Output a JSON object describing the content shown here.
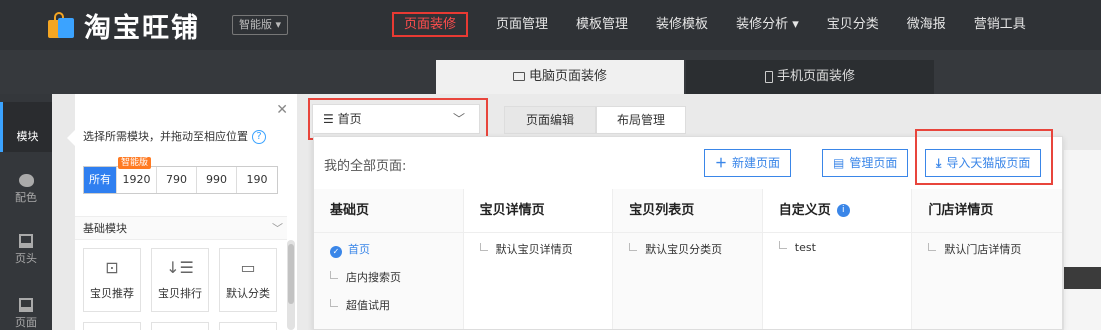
{
  "brand": {
    "name": "淘宝旺铺",
    "edition": "智能版 ▾"
  },
  "nav": [
    {
      "label": "页面装修",
      "active": true
    },
    {
      "label": "页面管理"
    },
    {
      "label": "模板管理"
    },
    {
      "label": "装修模板"
    },
    {
      "label": "装修分析 ▾"
    },
    {
      "label": "宝贝分类"
    },
    {
      "label": "微海报"
    },
    {
      "label": "营销工具"
    }
  ],
  "tabs": {
    "pc": "电脑页面装修",
    "mobile": "手机页面装修"
  },
  "rail": [
    {
      "label": "模块",
      "icon": "grid-icon",
      "active": true
    },
    {
      "label": "配色",
      "icon": "palette-icon"
    },
    {
      "label": "页头",
      "icon": "header-icon"
    },
    {
      "label": "页面",
      "icon": "page-icon"
    }
  ],
  "panel": {
    "hint": "选择所需模块，并拖动至相应位置",
    "help": "?",
    "widths": [
      "所有",
      "1920",
      "790",
      "990",
      "190"
    ],
    "width_badge": "智能版",
    "section": "基础模块",
    "modules": [
      {
        "label": "宝贝推荐",
        "icon": "bag-icon"
      },
      {
        "label": "宝贝排行",
        "icon": "sort-list-icon"
      },
      {
        "label": "默认分类",
        "icon": "category-icon"
      }
    ]
  },
  "toolbar": {
    "page_select": "首页",
    "edit_tab": "页面编辑",
    "layout_tab": "布局管理"
  },
  "dropdown": {
    "title": "我的全部页面:",
    "new_page": "新建页面",
    "manage_page": "管理页面",
    "import_page": "导入天猫版页面",
    "columns": [
      {
        "title": "基础页",
        "items": [
          "首页",
          "店内搜索页",
          "超值试用"
        ]
      },
      {
        "title": "宝贝详情页",
        "items": [
          "默认宝贝详情页"
        ]
      },
      {
        "title": "宝贝列表页",
        "items": [
          "默认宝贝分类页"
        ]
      },
      {
        "title": "自定义页",
        "items": [
          "test"
        ]
      },
      {
        "title": "门店详情页",
        "items": [
          "默认门店详情页"
        ]
      }
    ]
  },
  "colors": {
    "accent": "#3a86e8",
    "highlight": "#e8453c",
    "topbar": "#2f3236"
  }
}
